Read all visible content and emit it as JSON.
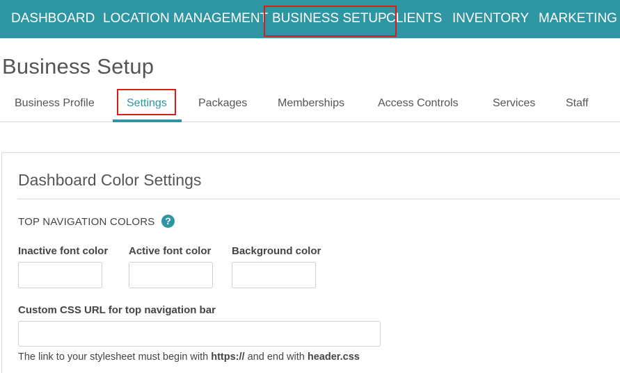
{
  "topnav": {
    "items": [
      {
        "label": "DASHBOARD"
      },
      {
        "label": "LOCATION MANAGEMENT"
      },
      {
        "label": "BUSINESS SETUP"
      },
      {
        "label": "CLIENTS"
      },
      {
        "label": "INVENTORY"
      },
      {
        "label": "MARKETING"
      }
    ]
  },
  "page": {
    "title": "Business Setup"
  },
  "tabs": [
    {
      "label": "Business Profile"
    },
    {
      "label": "Settings"
    },
    {
      "label": "Packages"
    },
    {
      "label": "Memberships"
    },
    {
      "label": "Access Controls"
    },
    {
      "label": "Services"
    },
    {
      "label": "Staff"
    }
  ],
  "panel": {
    "title": "Dashboard Color Settings",
    "section_label": "TOP NAVIGATION COLORS",
    "help_icon_glyph": "?",
    "fields": {
      "inactive_font_color": {
        "label": "Inactive font color",
        "value": ""
      },
      "active_font_color": {
        "label": "Active font color",
        "value": ""
      },
      "background_color": {
        "label": "Background color",
        "value": ""
      },
      "custom_css_url": {
        "label": "Custom CSS URL for top navigation bar",
        "value": ""
      }
    },
    "hint": {
      "prefix": "The link to your stylesheet must begin with ",
      "begin": "https://",
      "middle": " and end with ",
      "end": "header.css"
    }
  },
  "colors": {
    "accent": "#2e96a3",
    "highlight_border": "#d81b1b"
  }
}
